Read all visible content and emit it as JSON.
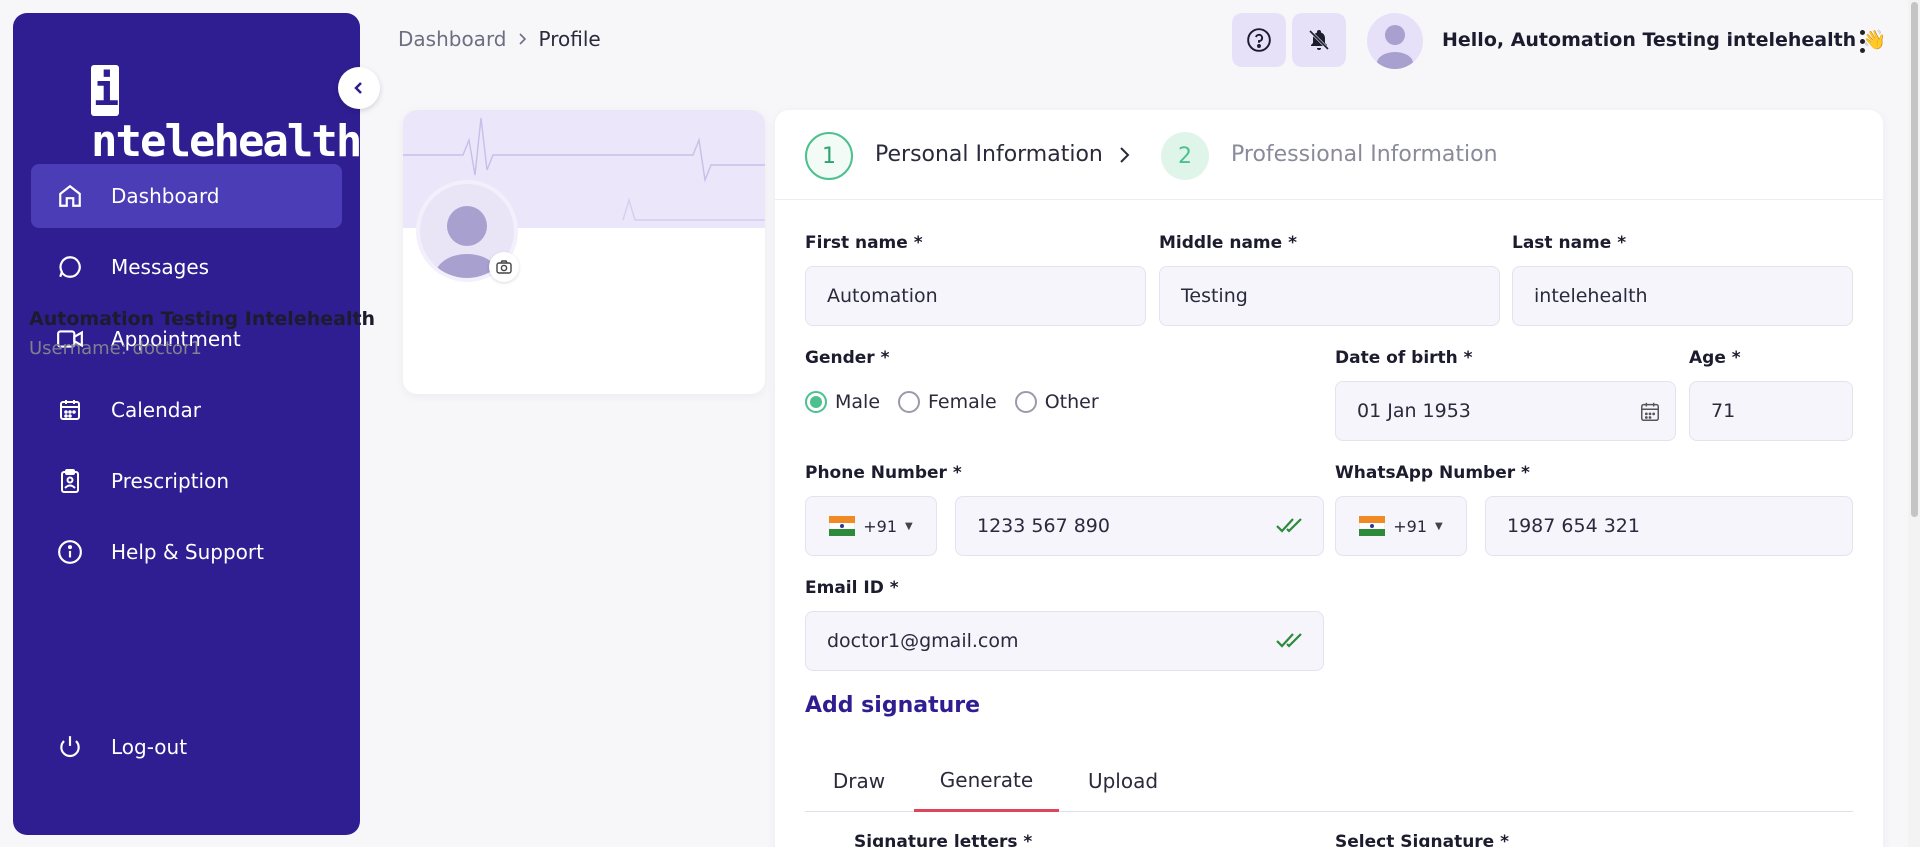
{
  "sidebar": {
    "logo": {
      "i": "i",
      "rest": "ntelehealth"
    },
    "items": [
      {
        "label": "Dashboard",
        "icon": "home-icon",
        "active": true
      },
      {
        "label": "Messages",
        "icon": "message-icon"
      },
      {
        "label": "Appointment",
        "icon": "video-icon"
      },
      {
        "label": "Calendar",
        "icon": "calendar-icon"
      },
      {
        "label": "Prescription",
        "icon": "clipboard-icon"
      },
      {
        "label": "Help & Support",
        "icon": "info-icon"
      }
    ],
    "logout_label": "Log-out"
  },
  "breadcrumb": {
    "root": "Dashboard",
    "current": "Profile"
  },
  "header": {
    "greeting": "Hello, Automation Testing intelehealth",
    "wave": "👋"
  },
  "profile": {
    "name": "Automation Testing Intelehealth",
    "username": "Username: doctor1"
  },
  "stepper": {
    "steps": [
      {
        "num": "1",
        "label": "Personal Information"
      },
      {
        "num": "2",
        "label": "Professional Information"
      }
    ]
  },
  "form": {
    "first_name": {
      "label": "First name *",
      "value": "Automation"
    },
    "middle_name": {
      "label": "Middle name *",
      "value": "Testing"
    },
    "last_name": {
      "label": "Last name *",
      "value": "intelehealth"
    },
    "gender": {
      "label": "Gender *",
      "options": [
        "Male",
        "Female",
        "Other"
      ],
      "selected": "Male"
    },
    "dob": {
      "label": "Date of birth *",
      "value": "01 Jan 1953"
    },
    "age": {
      "label": "Age *",
      "value": "71"
    },
    "phone": {
      "label": "Phone Number *",
      "code": "+91",
      "value": "1233 567 890"
    },
    "whatsapp": {
      "label": "WhatsApp Number *",
      "code": "+91",
      "value": "1987 654 321"
    },
    "email": {
      "label": "Email ID *",
      "value": "doctor1@gmail.com"
    }
  },
  "signature": {
    "title": "Add signature",
    "tabs": [
      "Draw",
      "Generate",
      "Upload"
    ],
    "active_tab": "Generate",
    "letters_label": "Signature letters *",
    "select_label": "Select Signature *"
  },
  "colors": {
    "sidebar": "#2e1e91",
    "active_nav": "#4a3db5",
    "accent_green": "#4cc08e",
    "tab_underline": "#e0445a"
  }
}
